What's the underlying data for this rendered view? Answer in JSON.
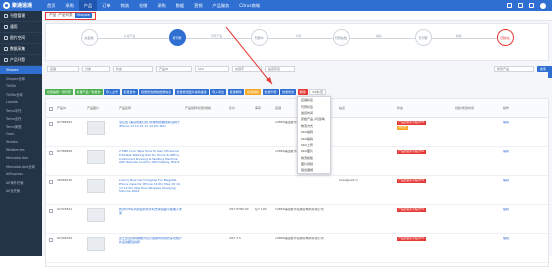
{
  "topbar": {
    "logo": "聚通速通",
    "nav": [
      "首页",
      "采购",
      "产品",
      "订单",
      "物流",
      "仓储",
      "采购",
      "数据",
      "营销",
      "产品服务",
      "Citrus商城"
    ],
    "active_index": 2
  },
  "sidebar": {
    "sections": [
      {
        "label": "刊登管理",
        "icon": "list-icon"
      },
      {
        "label": "通用",
        "icon": "grid-icon"
      },
      {
        "label": "图片空间",
        "icon": "image-icon"
      },
      {
        "label": "数据采集",
        "icon": "download-icon"
      },
      {
        "label": "产品刊登",
        "icon": "upload-icon"
      }
    ],
    "subitems": [
      "Shopee",
      "Shopee全球",
      "TikTok",
      "TikTok全球",
      "Lazada",
      "Temu半托",
      "Temu全托",
      "Temu美国",
      "Ozon",
      "Yandex",
      "Wildberries",
      "MercadoLibre",
      "MercadoLibre全球",
      "AliExpress",
      "AE海外托管",
      "AE全托管"
    ],
    "active_sub": "Shopee"
  },
  "breadcrumb": {
    "items": [
      "产品",
      "产品列表",
      "Shopee"
    ]
  },
  "flow": {
    "steps": [
      "采集箱",
      "待刊登",
      "刊登中",
      "刊登失败",
      "已刊登",
      "回收站"
    ],
    "current": 1,
    "middles": [
      "认领产品",
      "刊登产品",
      "同步",
      "编辑",
      "删除"
    ]
  },
  "filters": {
    "fields": [
      "店铺",
      "分类",
      "状态",
      "产品ID",
      "SKU",
      "关键字",
      "是否有货",
      "搜索产品"
    ],
    "button": "搜索"
  },
  "toolbar": {
    "buttons": [
      {
        "label": "批量编辑一键刊登",
        "color": "g"
      },
      {
        "label": "批量产品一键发布",
        "color": "g"
      },
      {
        "label": "导入主号",
        "color": "b"
      },
      {
        "label": "批量发布",
        "color": "b"
      },
      {
        "label": "批量修改规格数量信息",
        "color": "b"
      },
      {
        "label": "批量修改图片编码描述",
        "color": "b"
      },
      {
        "label": "导入导出",
        "color": "b"
      },
      {
        "label": "批量删除",
        "color": "b"
      },
      {
        "label": "批量编辑",
        "color": "o"
      },
      {
        "label": "批量刊登",
        "color": "b"
      },
      {
        "label": "批量修改",
        "color": "b"
      },
      {
        "label": "删除",
        "color": "r"
      },
      {
        "label": "50条/页",
        "color": "w"
      }
    ]
  },
  "table": {
    "headers": [
      "产品ID",
      "产品图片",
      "产品名称",
      "产品简称/标题/规格",
      "售价",
      "库存",
      "店铺",
      "站点",
      "状态",
      "创建/修改时间",
      "操作"
    ],
    "rows": [
      {
        "id": "62388981",
        "name": "全红色 (黑白色和红色 防滑防褶皱耐磨)适用于iPhone 13 14 15 11 12 Pro Max",
        "price": "",
        "stock": "",
        "shop": "12BKP美国夏尔克跨境电商有限公司",
        "site": "",
        "status_badges": [
          "产品质量需不超过5%",
          "待刊登"
        ],
        "time": "",
        "op": "编辑"
      },
      {
        "id": "62388965",
        "name": "2.5MP Lcon Tape Tune To Gen Ultrasonic Foldable Walking Pad for Home & Office, Cushioned Running & Walking Machine with Remote Control, LED Display, Black",
        "price": "",
        "stock": "",
        "shop": "12BKP美国夏尔克跨境电商有限公司",
        "site": "",
        "status_badges": [
          "产品质量需不超过5%"
        ],
        "time": "",
        "op": "编辑"
      },
      {
        "id": "58968120",
        "name": "Luxury Bow Card Original For Magsafe Phone Case for iPhone 16 Pro Max 15 14 13 12 Pro Max Plus Wireless Charging Silicone 2004",
        "price": "",
        "stock": "",
        "shop": "",
        "site": "headguelt.in",
        "status_badges": [
          "产品质量需不超过5%"
        ],
        "time": "",
        "op": "编辑"
      },
      {
        "id": "62324841",
        "name": "新款SVE系列铰链折叠手机支架桌面平板懒人支架",
        "price": "CNY 8789.00",
        "stock": "仅7 199",
        "shop": "12BKP美国夏尔克跨境电商有限公司",
        "site": "",
        "status_badges": [
          "产品质量需不超过5%"
        ],
        "time": "",
        "op": "编辑"
      },
      {
        "id": "62304062",
        "name": "女士复古款斜跨腰背包大容量时尚简约多功能户外运动腰包斜挎",
        "price": "CNY 2.5",
        "stock": "",
        "shop": "12BKP美国夏尔克跨境电商有限公司",
        "site": "",
        "status_badges": [
          "产品质量需不超过5%"
        ],
        "time": "",
        "op": "编辑"
      }
    ]
  },
  "dropdown": {
    "items": [
      "店铺标签",
      "刊登标签",
      "发货时间",
      "原始产品 (可选择)",
      "物流方式",
      "SKU编码",
      "SKU编码",
      "SKU上传",
      "SKU图片",
      "物流模板",
      "图片视频",
      "组合捆绑",
      "折扣",
      "修改描述"
    ]
  },
  "colors": {
    "primary": "#2f6fd1",
    "sidebar": "#243447",
    "danger": "#e53935",
    "success": "#4caf50",
    "warning": "#f5a623"
  }
}
